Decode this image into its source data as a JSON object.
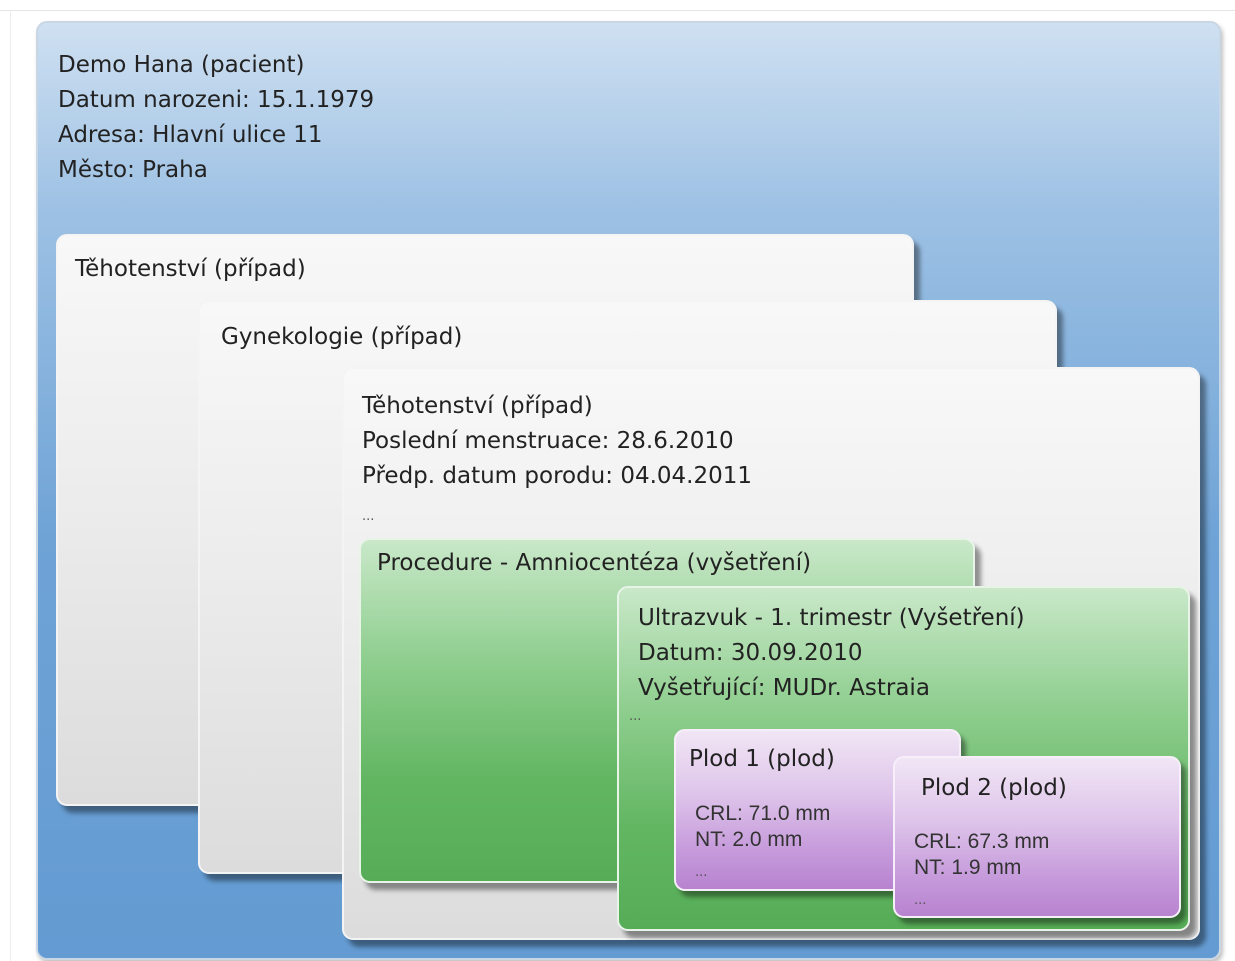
{
  "patient": {
    "lines": [
      "Demo Hana (pacient)",
      "Datum narozeni: 15.1.1979",
      "Adresa: Hlavní ulice 11",
      "Město: Praha"
    ]
  },
  "case_pregnancy_1": {
    "title": "Těhotenství (případ)"
  },
  "case_gynecology": {
    "title": "Gynekologie (případ)"
  },
  "case_pregnancy_2": {
    "lines": [
      "Těhotenství (případ)",
      "Poslední menstruace: 28.6.2010",
      "Předp. datum porodu: 04.04.2011"
    ],
    "ellipsis": "..."
  },
  "procedure": {
    "title": "Procedure - Amniocentéza (vyšetření)"
  },
  "ultrasound": {
    "lines": [
      "Ultrazvuk - 1. trimestr (Vyšetření)",
      "Datum: 30.09.2010",
      "Vyšetřující: MUDr. Astraia"
    ],
    "ellipsis": "..."
  },
  "fetus_1": {
    "title": "Plod 1 (plod)",
    "crl": "CRL: 71.0 mm",
    "nt": "NT: 2.0 mm",
    "ellipsis": "..."
  },
  "fetus_2": {
    "title": "Plod 2 (plod)",
    "crl": "CRL: 67.3 mm",
    "nt": "NT: 1.9 mm",
    "ellipsis": "..."
  },
  "colors": {
    "patient_blue": "#639bd2",
    "case_gray": "#e6e6e6",
    "exam_green": "#62b662",
    "fetus_purple": "#c69bdb"
  }
}
